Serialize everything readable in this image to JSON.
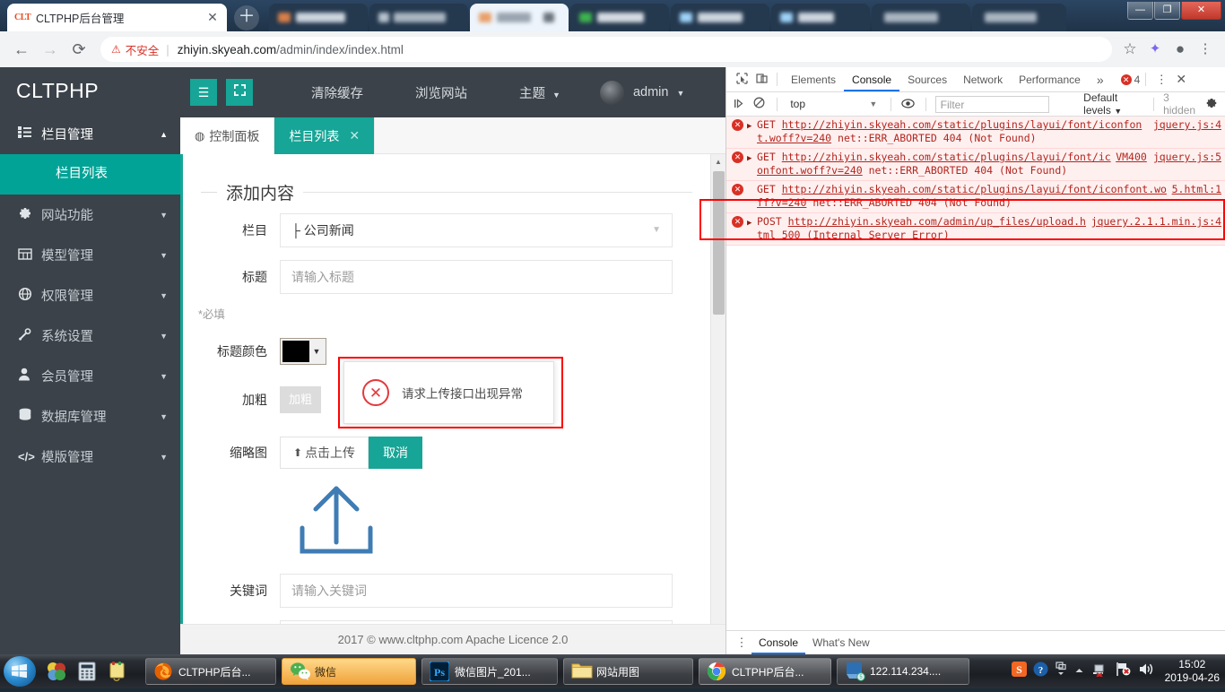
{
  "browser": {
    "tab": {
      "favicon_text": "CLT",
      "title": "CLTPHP后台管理",
      "close_icon": "✕"
    },
    "newtab_icon": "＋",
    "nav": {
      "back_icon": "←",
      "forward_icon": "→",
      "reload_icon": "⟳"
    },
    "omnibox": {
      "warning_icon": "⚠",
      "security_label": "不安全",
      "separator": "|",
      "url_host": "zhiyin.skyeah.com",
      "url_path": "/admin/index/index.html",
      "star_icon": "☆",
      "extension_icon": "✦",
      "profile_icon": "●",
      "menu_icon": "⋮"
    },
    "window_controls": {
      "minimize": "—",
      "restore": "❐",
      "close": "✕"
    }
  },
  "sidebar": {
    "brand": "CLTPHP",
    "items": [
      {
        "icon": "☰",
        "label": "栏目管理",
        "caret": "▲",
        "active": true
      },
      {
        "icon": "✿",
        "label": "网站功能",
        "caret": "▼"
      },
      {
        "icon": "▥",
        "label": "模型管理",
        "caret": "▼"
      },
      {
        "icon": "⊕",
        "label": "权限管理",
        "caret": "▼"
      },
      {
        "icon": "⚙",
        "label": "系统设置",
        "caret": "▼"
      },
      {
        "icon": "👤",
        "label": "会员管理",
        "caret": "▼"
      },
      {
        "icon": "🗄",
        "label": "数据库管理",
        "caret": "▼"
      },
      {
        "icon": "</>",
        "label": "模版管理",
        "caret": "▼"
      }
    ],
    "submenu_label": "栏目列表"
  },
  "admin_header": {
    "menu_icon": "☰",
    "fullscreen_icon": "⛶",
    "links": [
      "清除缓存",
      "浏览网站"
    ],
    "theme_label": "主题",
    "theme_caret": "▼",
    "user_label": "admin",
    "user_caret": "▼"
  },
  "admin_tabs": [
    {
      "icon": "◍",
      "label": "控制面板",
      "active": false
    },
    {
      "icon": "",
      "label": "栏目列表",
      "active": true,
      "close": "✕"
    }
  ],
  "form": {
    "legend": "添加内容",
    "category": {
      "label": "栏目",
      "value": "├ 公司新闻",
      "caret": "▼"
    },
    "title": {
      "label": "标题",
      "placeholder": "请输入标题"
    },
    "required_note": "*必填",
    "title_color": {
      "label": "标题颜色",
      "value": "#000000",
      "caret": "▼"
    },
    "bold": {
      "label": "加粗",
      "button_label": "加粗"
    },
    "thumbnail": {
      "label": "缩略图",
      "upload_label": "点击上传",
      "upload_icon": "⬆",
      "cancel_label": "取消"
    },
    "keywords": {
      "label": "关键词",
      "placeholder": "请输入关键词"
    }
  },
  "error_popup": {
    "icon": "✕",
    "message": "请求上传接口出现异常"
  },
  "footer": "2017 ©  www.cltphp.com  Apache Licence 2.0",
  "devtools": {
    "inspect_icon": "⬚",
    "device_icon": "❏",
    "tabs": [
      {
        "label": "Elements",
        "active": false
      },
      {
        "label": "Console",
        "active": true
      },
      {
        "label": "Sources",
        "active": false
      },
      {
        "label": "Network",
        "active": false
      },
      {
        "label": "Performance",
        "active": false
      }
    ],
    "more_tabs_icon": "»",
    "error_count": "4",
    "error_badge_icon": "✕",
    "menu_icon": "⋮",
    "close_icon": "✕",
    "filterbar": {
      "execute_icon": "▶|",
      "clear_icon": "🚫",
      "context": "top",
      "context_caret": "▼",
      "eye_icon": "◉",
      "filter_placeholder": "Filter",
      "levels_label": "Default levels",
      "levels_caret": "▼",
      "hidden_label": "3 hidden",
      "settings_icon": "⚙"
    },
    "messages": [
      {
        "method": "GET",
        "url": "http://zhiyin.skyeah.com/static/plugins/layui/font/iconfont.woff?v=240",
        "status": " net::ERR_ABORTED 404 (Not Found)",
        "source": "jquery.js:4",
        "vm": "",
        "expandable": true
      },
      {
        "method": "GET",
        "url": "http://zhiyin.skyeah.com/static/plugins/layui/font/iconfont.woff?v=240",
        "status": " net::ERR_ABORTED 404 (Not Found)",
        "source": "jquery.js:5",
        "vm": "VM400",
        "expandable": true
      },
      {
        "method": "GET",
        "url": "http://zhiyin.skyeah.com/static/plugins/layui/font/iconfont.woff?v=240",
        "status": " net::ERR_ABORTED 404 (Not Found)",
        "source": "5.html:1",
        "vm": "",
        "expandable": false
      },
      {
        "method": "POST",
        "url": "http://zhiyin.skyeah.com/admin/up_files/upload.html",
        "status": " 500 (Internal Server Error)",
        "source": "jquery.2.1.1.min.js:4",
        "vm": "",
        "expandable": true
      }
    ],
    "bottom": {
      "menu_icon": "⋮",
      "tabs": [
        {
          "label": "Console",
          "active": true
        },
        {
          "label": "What's New",
          "active": false
        }
      ]
    }
  },
  "taskbar": {
    "start_icon": "⊞",
    "quick_launch": [
      "app-icon",
      "calculator-icon",
      "notes-icon"
    ],
    "buttons": [
      {
        "label": "CLTPHP后台...",
        "icon": "firefox-icon"
      },
      {
        "label": "微信",
        "icon": "wechat-icon"
      },
      {
        "label": "微信图片_201...",
        "icon": "photoshop-icon"
      },
      {
        "label": "网站用图",
        "icon": "folder-icon"
      },
      {
        "label": "CLTPHP后台...",
        "icon": "chrome-icon"
      },
      {
        "label": "122.114.234....",
        "icon": "remote-desktop-icon"
      }
    ],
    "tray": [
      "sogou-icon",
      "help-icon",
      "show-hidden-icon",
      "network-icon",
      "flag-icon",
      "volume-icon"
    ],
    "clock_time": "15:02",
    "clock_date": "2019-04-26"
  }
}
